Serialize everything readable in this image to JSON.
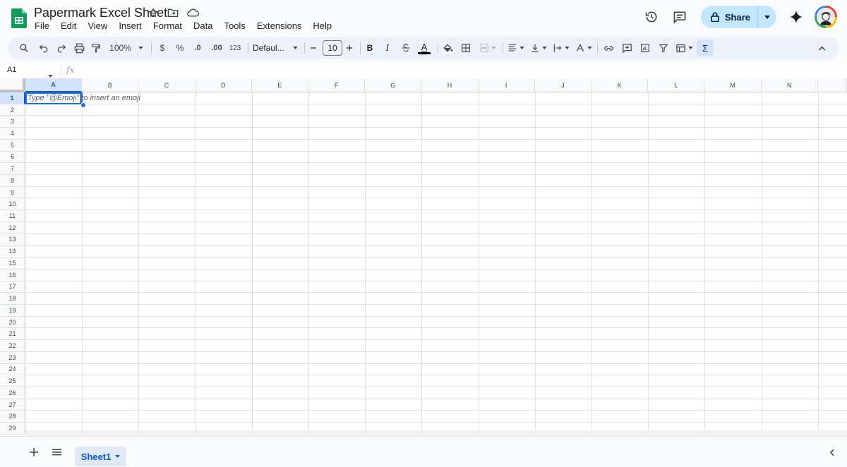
{
  "header": {
    "doc_title": "Papermark Excel Sheet",
    "menu": [
      "File",
      "Edit",
      "View",
      "Insert",
      "Format",
      "Data",
      "Tools",
      "Extensions",
      "Help"
    ],
    "share_label": "Share",
    "icons": [
      "history-icon",
      "comments-icon",
      "lock-icon",
      "gemini-sparkle-icon"
    ]
  },
  "toolbar": {
    "zoom": "100%",
    "currency": "$",
    "percent": "%",
    "decrease_decimal": ".0",
    "increase_decimal": ".00",
    "number_format": "123",
    "font_family": "Defaul...",
    "font_size": "10",
    "bold": "B",
    "italic": "I",
    "text_color": "A",
    "sum": "Σ"
  },
  "formula_bar": {
    "name_box": "A1",
    "fx_label": "fx",
    "value": ""
  },
  "grid": {
    "columns": [
      "A",
      "B",
      "C",
      "D",
      "E",
      "F",
      "G",
      "H",
      "I",
      "J",
      "K",
      "L",
      "M",
      "N"
    ],
    "rows": [
      "1",
      "2",
      "3",
      "4",
      "5",
      "6",
      "7",
      "8",
      "9",
      "10",
      "11",
      "12",
      "13",
      "14",
      "15",
      "16",
      "17",
      "18",
      "19",
      "20",
      "21",
      "22",
      "23",
      "24",
      "25",
      "26",
      "27",
      "28",
      "29"
    ],
    "selected_cell": "A1",
    "cell_hint": "Type \"@Emoji\" to insert an emoji"
  },
  "sheets": {
    "tabs": [
      {
        "label": "Sheet1",
        "active": true
      }
    ]
  },
  "colors": {
    "accent": "#0b57d0",
    "selection": "#1a73e8",
    "share_bg": "#c2e7ff",
    "toolbar_bg": "#edf2fa"
  }
}
